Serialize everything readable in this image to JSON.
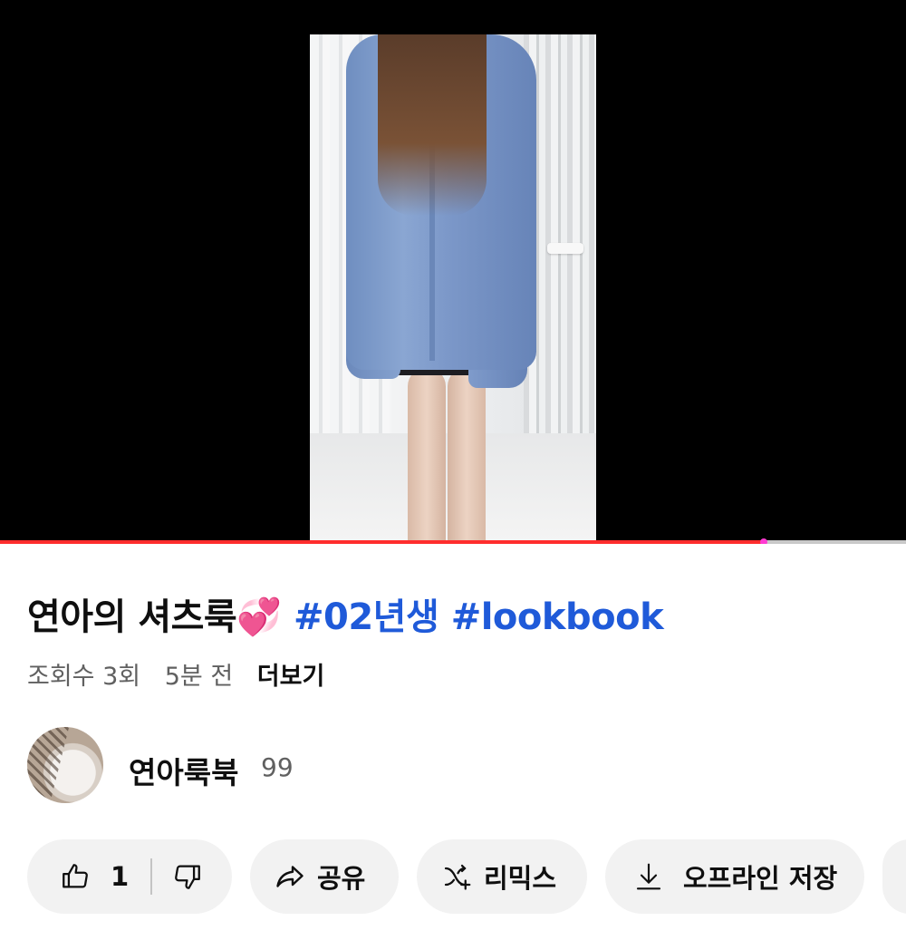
{
  "video": {
    "progress_fraction": 0.843
  },
  "title": {
    "text": "연아의 셔츠룩",
    "emoji": "💞",
    "hashtags": [
      "#02년생",
      "#lookbook"
    ]
  },
  "meta": {
    "views": "조회수 3회",
    "time": "5분 전",
    "more": "더보기"
  },
  "channel": {
    "name": "연아룩북",
    "subscribers": "99"
  },
  "actions": {
    "like_count": "1",
    "share": "공유",
    "remix": "리믹스",
    "download": "오프라인 저장"
  },
  "colors": {
    "accent_red": "#ff2d2d",
    "hashtag_blue": "#1f5ad9",
    "pill_bg": "#f2f2f2"
  },
  "icons": [
    "thumbs-up-icon",
    "thumbs-down-icon",
    "share-icon",
    "remix-icon",
    "download-icon"
  ]
}
